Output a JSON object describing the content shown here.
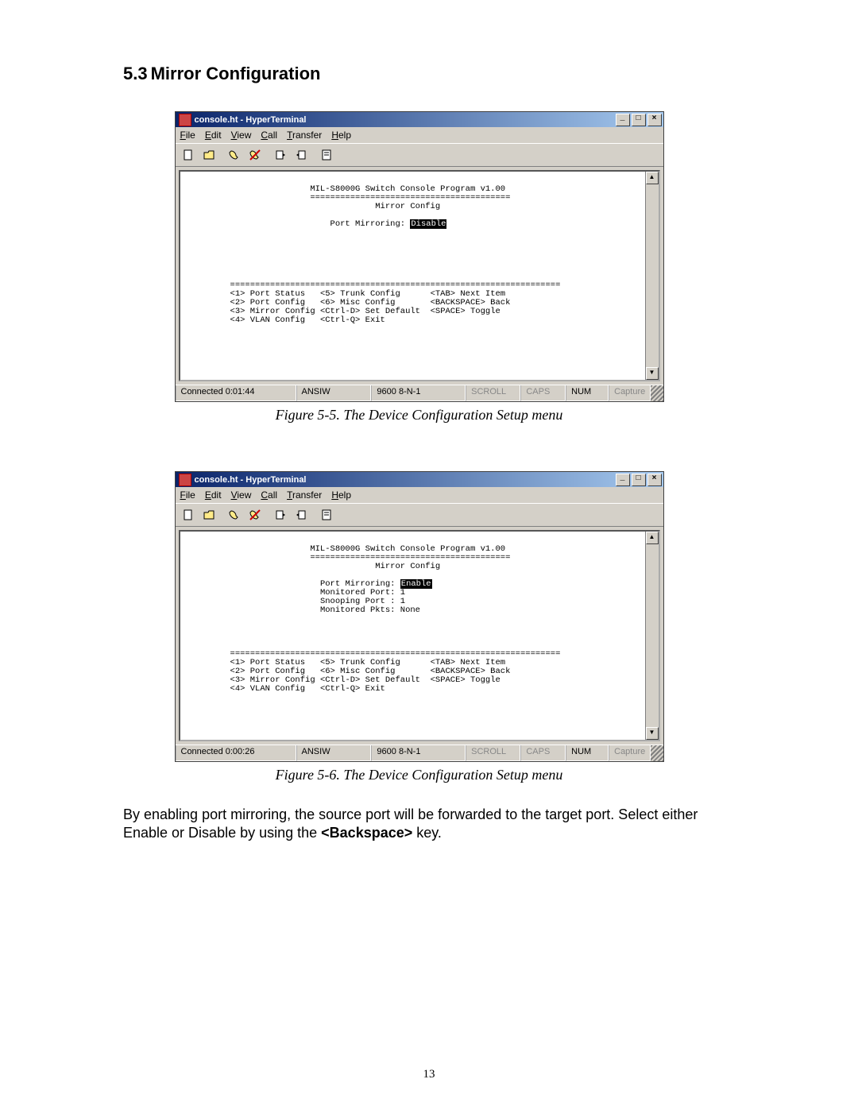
{
  "section": {
    "number": "5.3",
    "title": "Mirror Configuration"
  },
  "window1": {
    "title": "console.ht - HyperTerminal",
    "menu": {
      "file": "File",
      "edit": "Edit",
      "view": "View",
      "call": "Call",
      "transfer": "Transfer",
      "help": "Help"
    },
    "win_btns": {
      "min": "_",
      "max": "□",
      "close": "×"
    },
    "scroll": {
      "up": "▲",
      "down": "▼"
    },
    "console": {
      "program": "MIL-S8000G Switch Console Program v1.00",
      "divider": "========================================",
      "config_title": "Mirror Config",
      "mirroring_label": "Port Mirroring:",
      "mirroring_value": "Disable",
      "menu_divider": "==================================================================",
      "opt1": "<1> Port Status",
      "opt5": "<5> Trunk Config",
      "tab": "<TAB> Next Item",
      "opt2": "<2> Port Config",
      "opt6": "<6> Misc Config",
      "back": "<BACKSPACE> Back",
      "opt3": "<3> Mirror Config",
      "ctrld": "<Ctrl-D> Set Default",
      "toggle": "<SPACE> Toggle",
      "opt4": "<4> VLAN Config",
      "ctrlq": "<Ctrl-Q> Exit"
    },
    "status": {
      "connected": "Connected 0:01:44",
      "emul": "ANSIW",
      "port": "9600 8-N-1",
      "scroll": "SCROLL",
      "caps": "CAPS",
      "num": "NUM",
      "capture": "Capture"
    }
  },
  "figure1_caption": "Figure 5-5. The Device Configuration Setup menu",
  "window2": {
    "title": "console.ht - HyperTerminal",
    "menu": {
      "file": "File",
      "edit": "Edit",
      "view": "View",
      "call": "Call",
      "transfer": "Transfer",
      "help": "Help"
    },
    "win_btns": {
      "min": "_",
      "max": "□",
      "close": "×"
    },
    "scroll": {
      "up": "▲",
      "down": "▼"
    },
    "console": {
      "program": "MIL-S8000G Switch Console Program v1.00",
      "divider": "========================================",
      "config_title": "Mirror Config",
      "mirroring_label": "Port Mirroring:",
      "mirroring_value": "Enable",
      "monitored_label": "Monitored Port:",
      "monitored_value": "1",
      "snooping_label": "Snooping Port :",
      "snooping_value": "1",
      "pkts_label": "Monitored Pkts:",
      "pkts_value": "None",
      "menu_divider": "==================================================================",
      "opt1": "<1> Port Status",
      "opt5": "<5> Trunk Config",
      "tab": "<TAB> Next Item",
      "opt2": "<2> Port Config",
      "opt6": "<6> Misc Config",
      "back": "<BACKSPACE> Back",
      "opt3": "<3> Mirror Config",
      "ctrld": "<Ctrl-D> Set Default",
      "toggle": "<SPACE> Toggle",
      "opt4": "<4> VLAN Config",
      "ctrlq": "<Ctrl-Q> Exit"
    },
    "status": {
      "connected": "Connected 0:00:26",
      "emul": "ANSIW",
      "port": "9600 8-N-1",
      "scroll": "SCROLL",
      "caps": "CAPS",
      "num": "NUM",
      "capture": "Capture"
    }
  },
  "figure2_caption": "Figure 5-6. The Device Configuration Setup menu",
  "body_text_1": "By enabling port mirroring, the source port will be forwarded to the target port.  Select either Enable or Disable by using the ",
  "body_key": "<Backspace>",
  "body_text_2": " key.",
  "page_number": "13"
}
